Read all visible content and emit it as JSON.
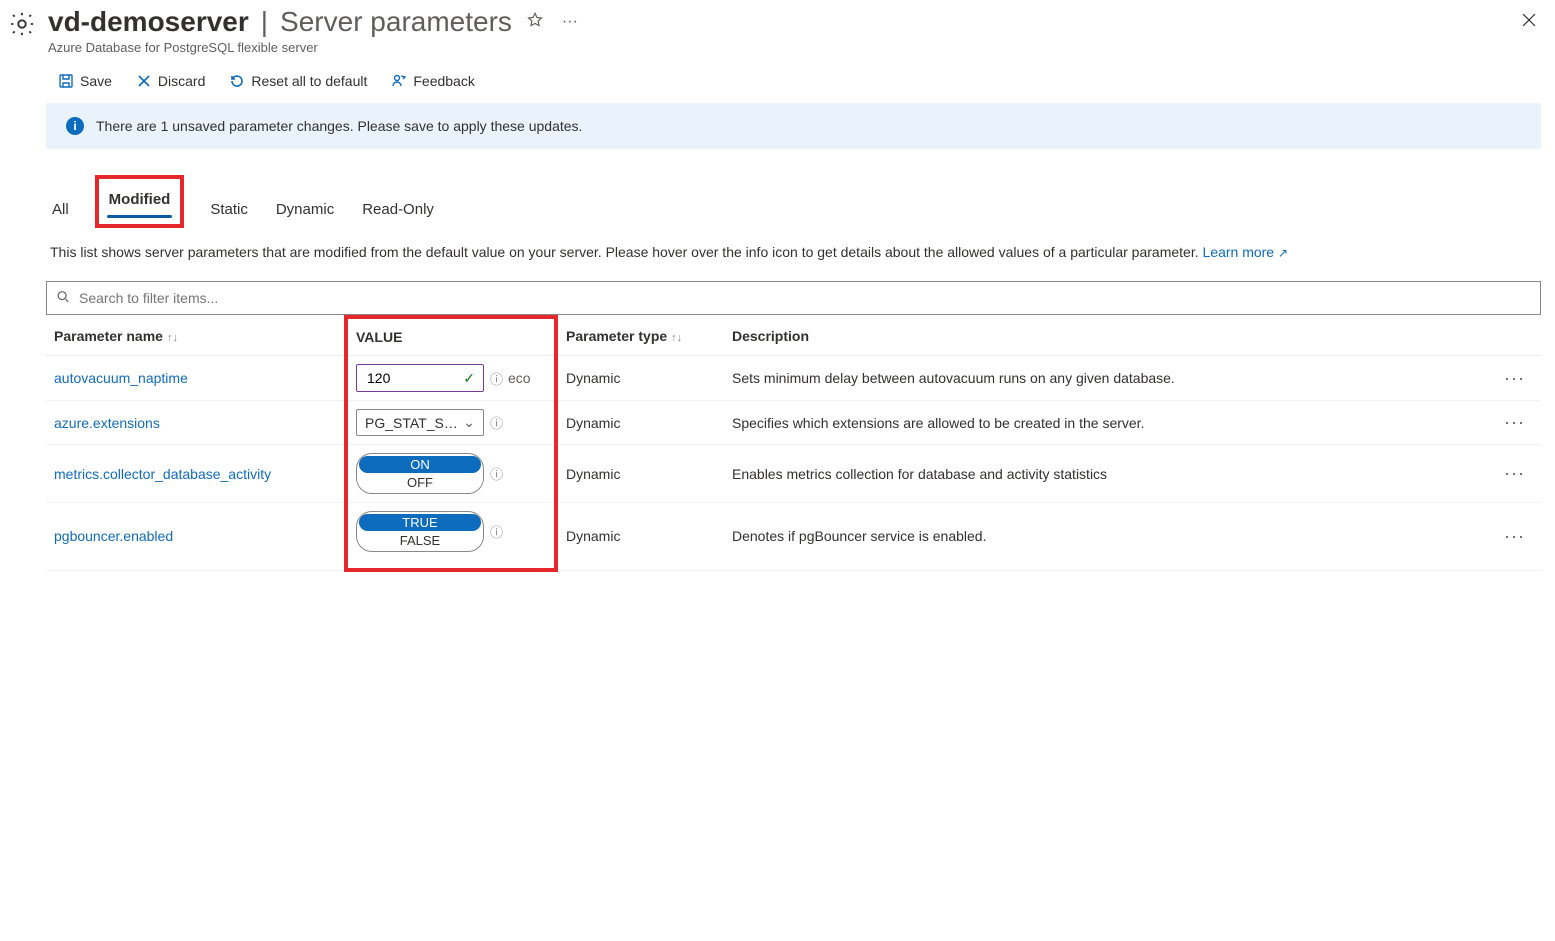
{
  "header": {
    "server_name": "vd-demoserver",
    "separator": "|",
    "page_title": "Server parameters",
    "subtitle": "Azure Database for PostgreSQL flexible server"
  },
  "toolbar": {
    "save_label": "Save",
    "discard_label": "Discard",
    "reset_label": "Reset all to default",
    "feedback_label": "Feedback"
  },
  "alert": {
    "text": "There are 1 unsaved parameter changes.  Please save to apply these updates."
  },
  "tabs": {
    "all": "All",
    "modified": "Modified",
    "static": "Static",
    "dynamic": "Dynamic",
    "readonly": "Read-Only"
  },
  "description": {
    "text": "This list shows server parameters that are modified from the default value on your server. Please hover over the info icon to get details about the allowed values of a particular parameter. ",
    "learn_more": "Learn more"
  },
  "search": {
    "placeholder": "Search to filter items..."
  },
  "columns": {
    "name": "Parameter name",
    "value": "VALUE",
    "type": "Parameter type",
    "description": "Description"
  },
  "rows": [
    {
      "name": "autovacuum_naptime",
      "value": "120",
      "value_kind": "text",
      "unit_fragment": "eco",
      "type": "Dynamic",
      "description": "Sets minimum delay between autovacuum runs on any given database."
    },
    {
      "name": "azure.extensions",
      "value": "PG_STAT_S…",
      "value_kind": "select",
      "type": "Dynamic",
      "description": "Specifies which extensions are allowed to be created in the server."
    },
    {
      "name": "metrics.collector_database_activity",
      "value_kind": "toggle",
      "toggle_on": "ON",
      "toggle_off": "OFF",
      "type": "Dynamic",
      "description": "Enables metrics collection for database and activity statistics"
    },
    {
      "name": "pgbouncer.enabled",
      "value_kind": "toggle",
      "toggle_on": "TRUE",
      "toggle_off": "FALSE",
      "type": "Dynamic",
      "description": "Denotes if pgBouncer service is enabled."
    }
  ]
}
